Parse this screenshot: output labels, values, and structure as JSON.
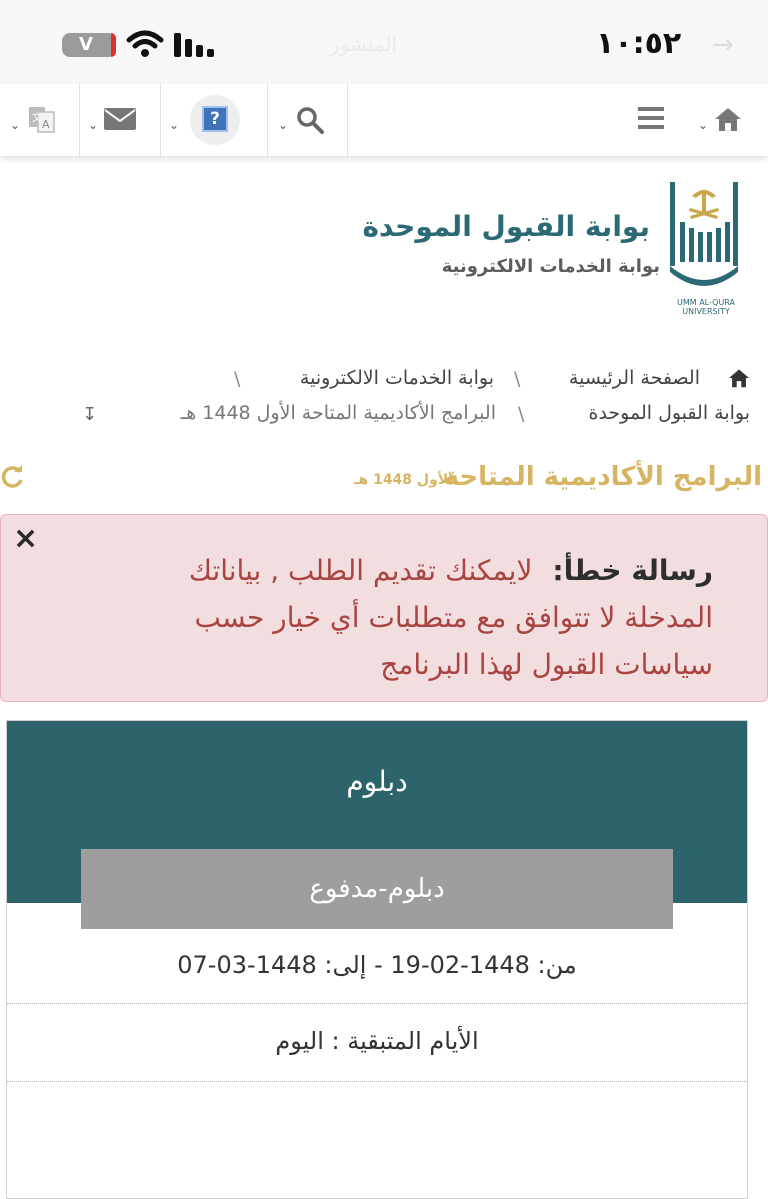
{
  "status_bar": {
    "battery": "V",
    "center_text": "المنشور",
    "time": "١٠:٥٢"
  },
  "toolbar": {
    "icons": [
      "home-icon",
      "menu-icon",
      "search-icon",
      "help-icon",
      "mail-icon",
      "translate-icon"
    ]
  },
  "brand": {
    "title": "بوابة القبول الموحدة",
    "subtitle": "بوابة الخدمات الالكترونية",
    "logo_caption": "UMM AL-QURA UNIVERSITY"
  },
  "breadcrumb": {
    "home": "الصفحة الرئيسية",
    "services": "بوابة الخدمات الالكترونية",
    "admission": "بوابة القبول الموحدة",
    "current": "البرامج الأكاديمية المتاحة الأول 1448 هـ",
    "separator": "\\"
  },
  "page": {
    "heading": "البرامج الأكاديمية المتاحة",
    "heading_sub": "الأول 1448 هـ"
  },
  "alert": {
    "label": "رسالة خطأ:",
    "message": "لايمكنك تقديم الطلب , بياناتك المدخلة لا تتوافق مع متطلبات أي خيار حسب سياسات القبول لهذا البرنامج",
    "close": "×"
  },
  "program_card": {
    "title": "دبلوم",
    "subtitle": "دبلوم-مدفوع",
    "date_range": "من: 1448-02-19 - إلى: 1448-03-07",
    "remaining_days": "الأيام المتبقية : اليوم"
  },
  "colors": {
    "teal": "#2d636b",
    "gold": "#d6b462",
    "alert_bg": "#f2dede",
    "alert_text": "#a94442"
  }
}
